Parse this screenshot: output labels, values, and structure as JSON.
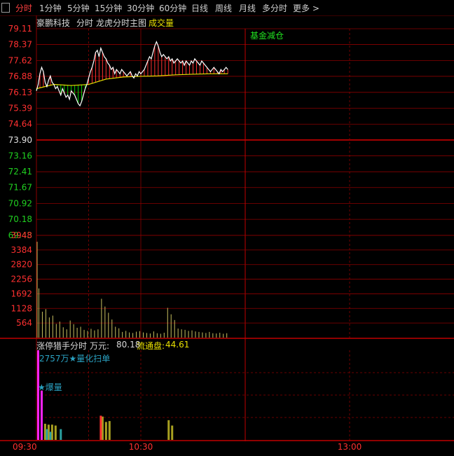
{
  "tabs": [
    {
      "label": "分时",
      "active": true
    },
    {
      "label": "1分钟"
    },
    {
      "label": "5分钟"
    },
    {
      "label": "15分钟"
    },
    {
      "label": "30分钟"
    },
    {
      "label": "60分钟"
    },
    {
      "label": "日线"
    },
    {
      "label": "周线"
    },
    {
      "label": "月线"
    },
    {
      "label": "多分时"
    },
    {
      "label": "更多"
    }
  ],
  "more_glyph": ">",
  "header": {
    "stock_name": "豪鹏科技",
    "mode": "分时",
    "indicator": "龙虎分时主图",
    "volume": "成交量"
  },
  "annotation": "基金减仓",
  "sub_header": {
    "label": "涨停猎手分时",
    "unit_label": "万元:",
    "unit_value": "80.18",
    "float_label": "流通盘:",
    "float_value": "44.61"
  },
  "sub_annotations": {
    "amount": "2757万★量化扫单",
    "burst": "★爆量"
  },
  "colors": {
    "up": "#ff3030",
    "down": "#00d000",
    "price": "#ffffff",
    "avg": "#e8e000",
    "grid": "#8b0000",
    "magenta": "#ff22ff",
    "olive": "#a8a020",
    "teal": "#2aa0a0"
  },
  "chart_data": [
    {
      "type": "line",
      "name": "intraday-price",
      "prev_close": 73.9,
      "ylim": [
        69.43,
        79.11
      ],
      "y_ticks": [
        "79.11",
        "78.37",
        "77.62",
        "76.88",
        "76.13",
        "75.39",
        "74.64",
        "73.90",
        "73.16",
        "72.41",
        "71.67",
        "70.92",
        "70.18",
        "69.43"
      ],
      "x_ticks": [
        "09:30",
        "10:30",
        "13:00"
      ],
      "x_range_minutes": [
        0,
        240
      ],
      "series": [
        {
          "role": "price",
          "x": [
            0,
            1,
            2,
            3,
            4,
            5,
            6,
            7,
            8,
            9,
            10,
            11,
            12,
            13,
            14,
            15,
            16,
            17,
            18,
            19,
            20,
            21,
            22,
            23,
            24,
            25,
            26,
            27,
            28,
            29,
            30,
            31,
            32,
            33,
            34,
            35,
            36,
            37,
            38,
            39,
            40,
            41,
            42,
            43,
            44,
            45,
            46,
            47,
            48,
            49,
            50,
            51,
            52,
            53,
            54,
            55,
            56,
            57,
            58,
            59,
            60,
            61,
            62,
            63,
            64,
            65,
            66,
            67,
            68,
            69,
            70,
            71,
            72,
            73,
            74,
            75,
            76,
            77,
            78,
            79,
            80,
            81,
            82,
            83,
            84,
            85,
            86,
            87,
            88,
            89,
            90,
            91,
            92,
            93,
            94,
            95,
            96,
            97,
            98,
            99,
            100,
            101,
            102,
            103,
            104,
            105,
            106,
            107,
            108,
            109,
            110
          ],
          "y": [
            76.2,
            76.5,
            77.0,
            77.3,
            77.1,
            76.6,
            76.4,
            76.7,
            76.9,
            76.6,
            76.5,
            76.3,
            76.4,
            76.2,
            76.0,
            76.3,
            76.1,
            75.9,
            76.0,
            75.8,
            76.2,
            76.1,
            76.0,
            75.8,
            75.6,
            75.5,
            75.7,
            76.0,
            76.3,
            76.5,
            76.8,
            77.1,
            77.3,
            77.6,
            78.0,
            78.1,
            77.8,
            78.2,
            78.0,
            77.8,
            77.7,
            77.5,
            77.4,
            77.2,
            77.3,
            77.0,
            77.2,
            77.1,
            77.0,
            77.2,
            77.1,
            77.0,
            76.9,
            77.0,
            77.1,
            76.9,
            76.8,
            77.0,
            76.9,
            77.1,
            77.0,
            77.1,
            77.2,
            77.4,
            77.6,
            77.8,
            77.7,
            78.0,
            78.3,
            78.5,
            78.3,
            78.0,
            77.8,
            77.9,
            77.8,
            77.7,
            77.8,
            77.6,
            77.7,
            77.5,
            77.6,
            77.7,
            77.6,
            77.5,
            77.6,
            77.4,
            77.6,
            77.5,
            77.4,
            77.6,
            77.5,
            77.7,
            77.6,
            77.5,
            77.4,
            77.6,
            77.5,
            77.4,
            77.3,
            77.2,
            77.1,
            77.2,
            77.3,
            77.2,
            77.1,
            77.0,
            77.2,
            77.1,
            77.2,
            77.3,
            77.2
          ]
        },
        {
          "role": "average",
          "x": [
            0,
            10,
            20,
            30,
            40,
            50,
            60,
            70,
            80,
            90,
            100,
            110
          ],
          "y": [
            76.3,
            76.5,
            76.45,
            76.5,
            76.75,
            76.85,
            76.88,
            76.9,
            76.95,
            76.98,
            77.0,
            77.0
          ]
        }
      ]
    },
    {
      "type": "bar",
      "name": "volume",
      "ylim": [
        0,
        3948
      ],
      "y_ticks": [
        "3948",
        "3384",
        "2820",
        "2256",
        "1692",
        "1128",
        "564"
      ],
      "x": [
        0,
        1,
        3,
        5,
        7,
        9,
        11,
        13,
        15,
        17,
        19,
        21,
        23,
        25,
        27,
        29,
        31,
        33,
        35,
        37,
        39,
        41,
        43,
        45,
        47,
        49,
        51,
        53,
        55,
        57,
        59,
        61,
        63,
        65,
        67,
        69,
        71,
        73,
        75,
        77,
        79,
        81,
        83,
        85,
        87,
        89,
        91,
        93,
        95,
        97,
        99,
        101,
        103,
        105,
        107,
        109
      ],
      "values": [
        3700,
        1900,
        1000,
        1100,
        780,
        850,
        530,
        620,
        400,
        320,
        660,
        520,
        380,
        420,
        300,
        260,
        340,
        280,
        320,
        1500,
        1200,
        960,
        700,
        420,
        360,
        220,
        260,
        200,
        180,
        230,
        250,
        200,
        180,
        160,
        240,
        170,
        150,
        190,
        1150,
        900,
        680,
        350,
        320,
        300,
        260,
        280,
        240,
        220,
        200,
        180,
        220,
        170,
        160,
        190,
        150,
        170
      ]
    },
    {
      "type": "bar",
      "name": "limit-up-hunter",
      "series": [
        {
          "name": "magenta",
          "x": [
            0,
            2
          ],
          "values": [
            100,
            55
          ]
        },
        {
          "name": "olive",
          "x": [
            4,
            6,
            8,
            10,
            37,
            39,
            41,
            75,
            77
          ],
          "values": [
            18,
            17,
            17,
            16,
            26,
            20,
            21,
            22,
            16
          ]
        },
        {
          "name": "teal",
          "x": [
            5,
            7,
            13
          ],
          "values": [
            12,
            9,
            12
          ]
        },
        {
          "name": "red",
          "x": [
            36
          ],
          "values": [
            27
          ]
        }
      ]
    }
  ]
}
